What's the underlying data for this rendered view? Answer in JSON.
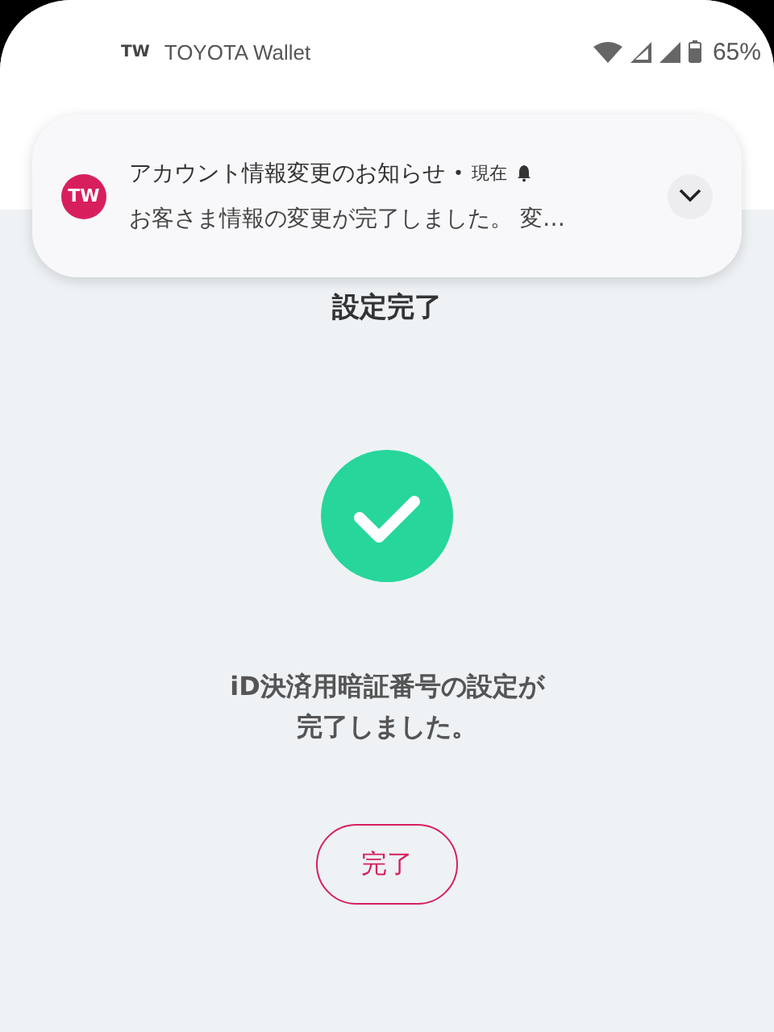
{
  "status_bar": {
    "app_mark": "TW",
    "app_name": "TOYOTA Wallet",
    "battery": "65%"
  },
  "notification": {
    "app_badge": "TW",
    "title": "アカウント情報変更のお知らせ",
    "separator": "•",
    "time": "現在",
    "message": "お客さま情報の変更が完了しました。 変…",
    "expanded": false
  },
  "screen": {
    "title": "設定完了",
    "message_lines": [
      "iD決済用暗証番号の設定が",
      "完了しました。"
    ],
    "button": "完了"
  }
}
